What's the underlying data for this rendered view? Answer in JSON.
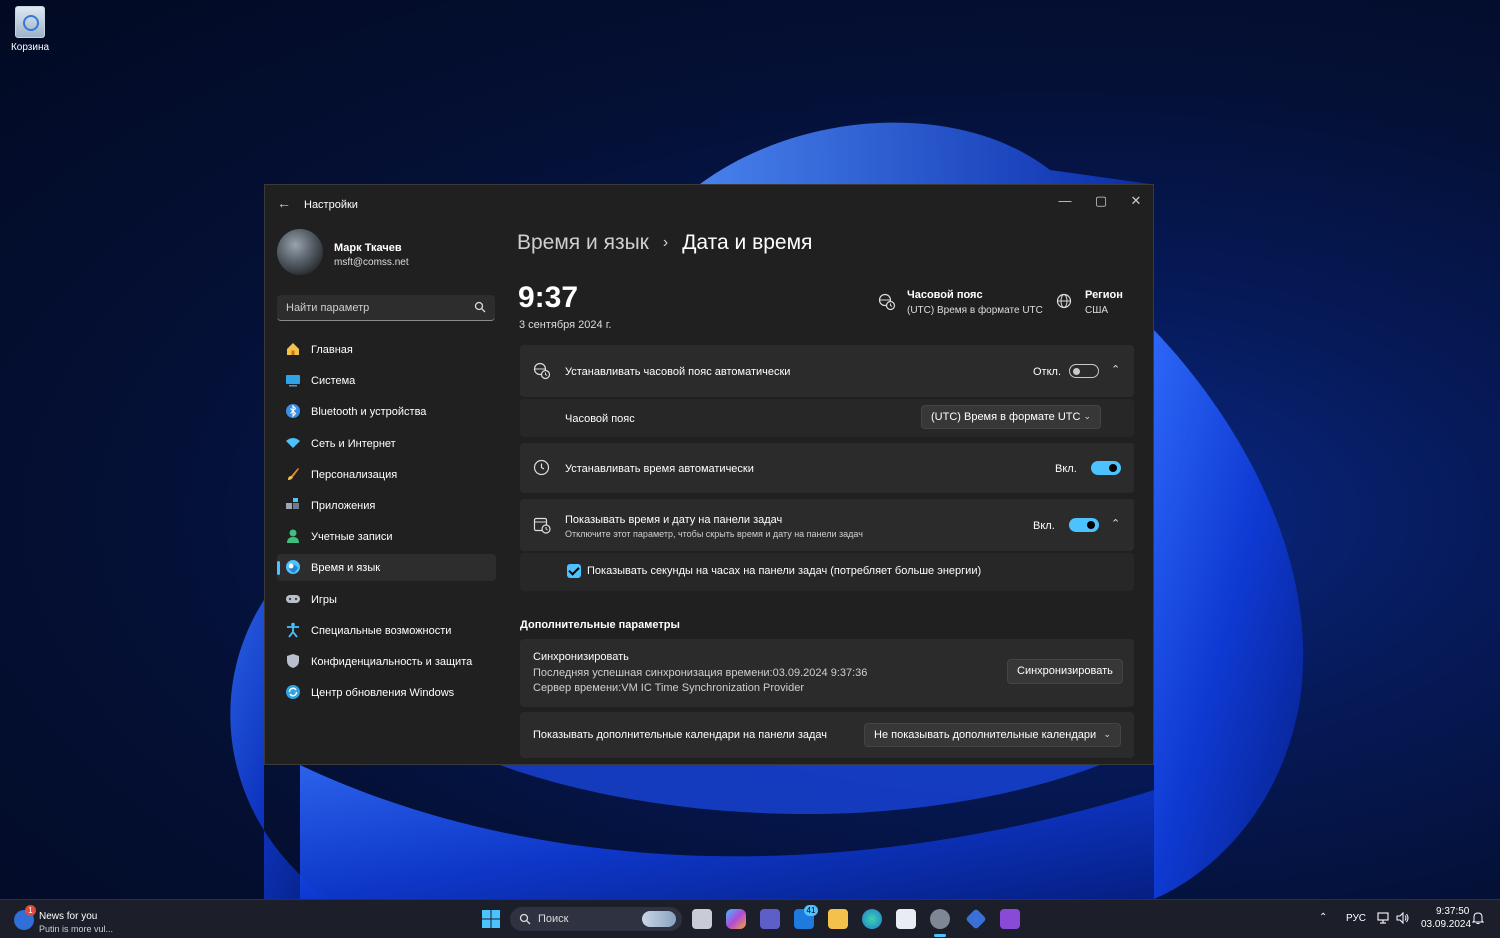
{
  "desktop": {
    "recycle_bin_label": "Корзина"
  },
  "window": {
    "app_title": "Настройки",
    "controls": {
      "minimize": "—",
      "maximize": "▢",
      "close": "✕"
    }
  },
  "user": {
    "name": "Марк Ткачев",
    "email": "msft@comss.net"
  },
  "search": {
    "placeholder": "Найти параметр"
  },
  "nav": {
    "items": [
      {
        "label": "Главная",
        "icon": "home-icon",
        "color": "#f4c14a"
      },
      {
        "label": "Система",
        "icon": "system-icon",
        "color": "#2fa3e6"
      },
      {
        "label": "Bluetooth и устройства",
        "icon": "bluetooth-icon",
        "color": "#3a8ee6"
      },
      {
        "label": "Сеть и Интернет",
        "icon": "network-icon",
        "color": "#4cc2ff"
      },
      {
        "label": "Персонализация",
        "icon": "brush-icon",
        "color": "#e8873a"
      },
      {
        "label": "Приложения",
        "icon": "apps-icon",
        "color": "#9aa6b8"
      },
      {
        "label": "Учетные записи",
        "icon": "account-icon",
        "color": "#3fbf7f"
      },
      {
        "label": "Время и язык",
        "icon": "time-language-icon",
        "color": "#4cc2ff",
        "selected": true
      },
      {
        "label": "Игры",
        "icon": "gamepad-icon",
        "color": "#b9c0cc"
      },
      {
        "label": "Специальные возможности",
        "icon": "accessibility-icon",
        "color": "#4cc2ff"
      },
      {
        "label": "Конфиденциальность и защита",
        "icon": "shield-icon",
        "color": "#b9c0cc"
      },
      {
        "label": "Центр обновления Windows",
        "icon": "update-icon",
        "color": "#2fa3e6"
      }
    ]
  },
  "breadcrumb": {
    "parent": "Время и язык",
    "separator": "›",
    "current": "Дата и время"
  },
  "clock": {
    "time": "9:37",
    "date": "3 сентября 2024 г."
  },
  "timezone_info": {
    "heading": "Часовой пояс",
    "value": "(UTC) Время в формате UTC"
  },
  "region_info": {
    "heading": "Регион",
    "value": "США"
  },
  "settings": {
    "auto_timezone": {
      "label": "Устанавливать часовой пояс автоматически",
      "state": "Откл.",
      "on": false
    },
    "timezone": {
      "label": "Часовой пояс",
      "value": "(UTC) Время в формате UTC"
    },
    "auto_time": {
      "label": "Устанавливать время автоматически",
      "state": "Вкл.",
      "on": true
    },
    "show_taskbar_time": {
      "label": "Показывать время и дату на панели задач",
      "sublabel": "Отключите этот параметр, чтобы скрыть время и дату на панели задач",
      "state": "Вкл.",
      "on": true
    },
    "show_seconds": {
      "label": "Показывать секунды на часах на панели задач (потребляет больше энергии)",
      "checked": true
    }
  },
  "additional": {
    "heading": "Дополнительные параметры",
    "sync": {
      "title": "Синхронизировать",
      "last_sync": "Последняя успешная синхронизация времени:03.09.2024 9:37:36",
      "server": "Сервер времени:VM IC Time Synchronization Provider",
      "button": "Синхронизировать"
    },
    "calendars": {
      "label": "Показывать дополнительные календари на панели задач",
      "value": "Не показывать дополнительные календари"
    }
  },
  "taskbar": {
    "news": {
      "title": "News for you",
      "subtitle": "Putin is more vul...",
      "badge": "1"
    },
    "search_label": "Поиск",
    "mail_badge": "41",
    "language": "РУС",
    "time": "9:37:50",
    "date": "03.09.2024",
    "accent": "#4cc2ff"
  }
}
